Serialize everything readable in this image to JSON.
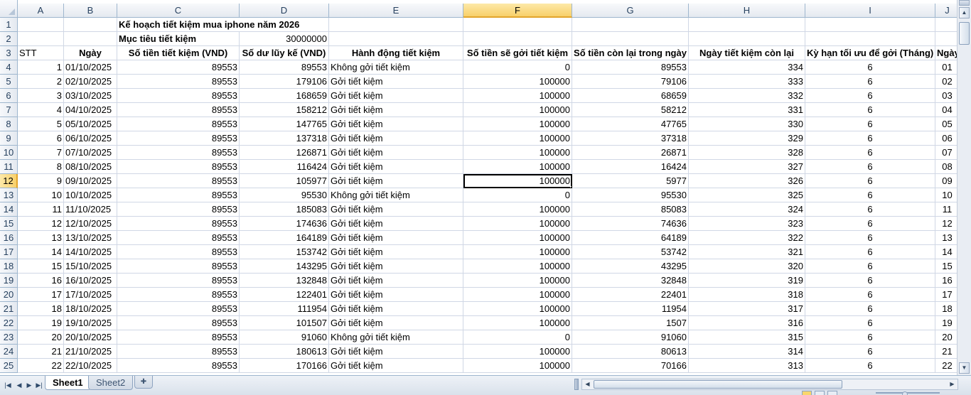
{
  "app": {
    "active_sheet": "Sheet1",
    "sheet_tabs": [
      "Sheet1",
      "Sheet2"
    ]
  },
  "columns": [
    "A",
    "B",
    "C",
    "D",
    "E",
    "F",
    "G",
    "H",
    "I",
    "J"
  ],
  "row_numbers": [
    "1",
    "2",
    "3",
    "4",
    "5",
    "6",
    "7",
    "8",
    "9",
    "10",
    "11",
    "12",
    "13",
    "14",
    "15",
    "16",
    "17",
    "18",
    "19",
    "20",
    "21",
    "22",
    "23",
    "24",
    "25"
  ],
  "selection": {
    "column": "F",
    "row": "12"
  },
  "title_rows": {
    "plan_title": "Kế hoạch tiết kiệm mua iphone năm 2026",
    "goal_label": "Mục tiêu tiết kiệm",
    "goal_value": "30000000"
  },
  "headers": [
    "STT",
    "Ngày",
    "Số tiền tiết kiệm (VND)",
    "Số dư lũy kế (VND)",
    "Hành động tiết kiệm",
    "Số tiền sẽ gởi tiết kiệm",
    "Số tiền còn lại trong ngày",
    "Ngày tiết kiệm còn lại",
    "Kỳ hạn tối ưu để gởi (Tháng)",
    "Ngày"
  ],
  "rows": [
    [
      "1",
      "01/10/2025",
      "89553",
      "89553",
      "Không gởi tiết kiệm",
      "0",
      "89553",
      "334",
      "6",
      "01"
    ],
    [
      "2",
      "02/10/2025",
      "89553",
      "179106",
      "Gởi tiết kiệm",
      "100000",
      "79106",
      "333",
      "6",
      "02"
    ],
    [
      "3",
      "03/10/2025",
      "89553",
      "168659",
      "Gởi tiết kiệm",
      "100000",
      "68659",
      "332",
      "6",
      "03"
    ],
    [
      "4",
      "04/10/2025",
      "89553",
      "158212",
      "Gởi tiết kiệm",
      "100000",
      "58212",
      "331",
      "6",
      "04"
    ],
    [
      "5",
      "05/10/2025",
      "89553",
      "147765",
      "Gởi tiết kiệm",
      "100000",
      "47765",
      "330",
      "6",
      "05"
    ],
    [
      "6",
      "06/10/2025",
      "89553",
      "137318",
      "Gởi tiết kiệm",
      "100000",
      "37318",
      "329",
      "6",
      "06"
    ],
    [
      "7",
      "07/10/2025",
      "89553",
      "126871",
      "Gởi tiết kiệm",
      "100000",
      "26871",
      "328",
      "6",
      "07"
    ],
    [
      "8",
      "08/10/2025",
      "89553",
      "116424",
      "Gởi tiết kiệm",
      "100000",
      "16424",
      "327",
      "6",
      "08"
    ],
    [
      "9",
      "09/10/2025",
      "89553",
      "105977",
      "Gởi tiết kiệm",
      "100000",
      "5977",
      "326",
      "6",
      "09"
    ],
    [
      "10",
      "10/10/2025",
      "89553",
      "95530",
      "Không gởi tiết kiệm",
      "0",
      "95530",
      "325",
      "6",
      "10"
    ],
    [
      "11",
      "11/10/2025",
      "89553",
      "185083",
      "Gởi tiết kiệm",
      "100000",
      "85083",
      "324",
      "6",
      "11"
    ],
    [
      "12",
      "12/10/2025",
      "89553",
      "174636",
      "Gởi tiết kiệm",
      "100000",
      "74636",
      "323",
      "6",
      "12"
    ],
    [
      "13",
      "13/10/2025",
      "89553",
      "164189",
      "Gởi tiết kiệm",
      "100000",
      "64189",
      "322",
      "6",
      "13"
    ],
    [
      "14",
      "14/10/2025",
      "89553",
      "153742",
      "Gởi tiết kiệm",
      "100000",
      "53742",
      "321",
      "6",
      "14"
    ],
    [
      "15",
      "15/10/2025",
      "89553",
      "143295",
      "Gởi tiết kiệm",
      "100000",
      "43295",
      "320",
      "6",
      "15"
    ],
    [
      "16",
      "16/10/2025",
      "89553",
      "132848",
      "Gởi tiết kiệm",
      "100000",
      "32848",
      "319",
      "6",
      "16"
    ],
    [
      "17",
      "17/10/2025",
      "89553",
      "122401",
      "Gởi tiết kiệm",
      "100000",
      "22401",
      "318",
      "6",
      "17"
    ],
    [
      "18",
      "18/10/2025",
      "89553",
      "111954",
      "Gởi tiết kiệm",
      "100000",
      "11954",
      "317",
      "6",
      "18"
    ],
    [
      "19",
      "19/10/2025",
      "89553",
      "101507",
      "Gởi tiết kiệm",
      "100000",
      "1507",
      "316",
      "6",
      "19"
    ],
    [
      "20",
      "20/10/2025",
      "89553",
      "91060",
      "Không gởi tiết kiệm",
      "0",
      "91060",
      "315",
      "6",
      "20"
    ],
    [
      "21",
      "21/10/2025",
      "89553",
      "180613",
      "Gởi tiết kiệm",
      "100000",
      "80613",
      "314",
      "6",
      "21"
    ],
    [
      "22",
      "22/10/2025",
      "89553",
      "170166",
      "Gởi tiết kiệm",
      "100000",
      "70166",
      "313",
      "6",
      "22"
    ]
  ],
  "icons": {
    "nav_first": "first-sheet-icon",
    "nav_prev": "prev-sheet-icon",
    "nav_next": "next-sheet-icon",
    "nav_last": "last-sheet-icon",
    "new_sheet": "insert-worksheet-icon"
  },
  "colors": {
    "grid_line": "#d0d7e5",
    "header_bg": "#e4e9f0",
    "selected_header": "#f8d06a"
  }
}
